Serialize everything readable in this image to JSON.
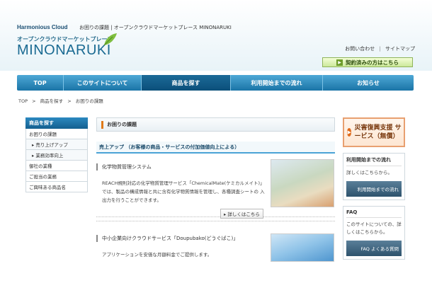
{
  "header": {
    "brand": "Harmonious Cloud",
    "tagline": "お困りの課題 | オープンクラウドマーケットプレース MINONARUKI",
    "logo_sub": "オープンクラウドマーケットプレース",
    "logo_main": "MINONARUKI",
    "links": [
      "お問い合わせ",
      "サイトマップ"
    ],
    "link_sep": "|",
    "contract_button": "契約済みの方はこちら"
  },
  "nav": {
    "items": [
      "TOP",
      "このサイトについて",
      "商品を探す",
      "利用開始までの流れ",
      "お知らせ"
    ],
    "active_index": 2
  },
  "breadcrumb": [
    "TOP",
    "商品を探す",
    "お困りの課題"
  ],
  "breadcrumb_sep": ">",
  "sidebar": {
    "head": "商品を探す",
    "items": [
      {
        "label": "お困りの課題",
        "sub": false
      },
      {
        "label": "▸ 売り上げアップ",
        "sub": true
      },
      {
        "label": "▸ 業務効率向上",
        "sub": true
      },
      {
        "label": "御社の業種",
        "sub": false
      },
      {
        "label": "ご担当の業務",
        "sub": false
      },
      {
        "label": "ご興味ある商品名",
        "sub": false
      }
    ]
  },
  "main": {
    "title": "お困りの課題",
    "section": "売上アップ （お客様の商品・サービスの付加価値向上による）",
    "item1_title": "化学物質管理システム",
    "item1_desc": "REACH規則対応の化学物質管理サービス「ChemicalMate(ケミカルメイト)」では、製品の構成情報と共に含有化学物質情報を管理し、各種調査シートの 入出力を行うことができます。",
    "detail_button": "▸ 詳しくはこちら",
    "item2_title": "中小企業向けクラウドサービス「Doupubako(どうぐばこ)」",
    "item2_desc": "アプリケーションを安価な月額料金でご提供します。"
  },
  "right": {
    "disaster": "災害復興支援 サービス（無償）",
    "disaster_icon": "▶",
    "box1_head": "利用開始までの流れ",
    "box1_text": "詳しくはこちらから。",
    "box1_btn": "利用開始までの流れ",
    "box2_head": "FAQ",
    "box2_text": "このサイトについての、詳しくはこちらから。",
    "box2_btn": "FAQ よくある質問"
  }
}
